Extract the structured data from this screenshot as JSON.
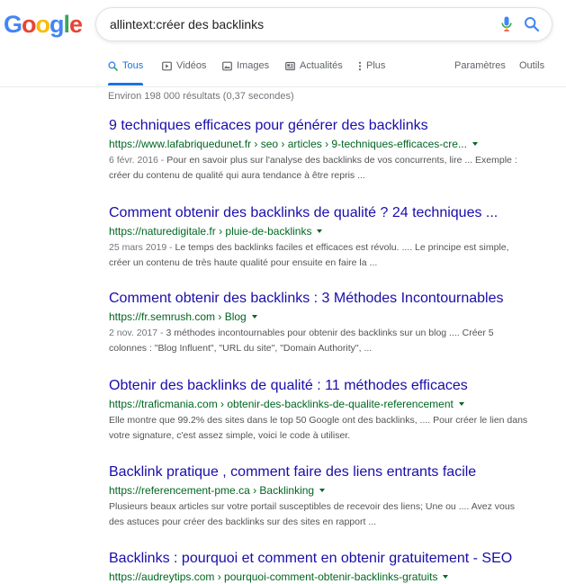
{
  "logo": {
    "l1": "G",
    "l2": "o",
    "l3": "o",
    "l4": "g",
    "l5": "l",
    "l6": "e"
  },
  "search": {
    "query": "allintext:créer des backlinks"
  },
  "icons": {
    "mic": "microphone-icon",
    "search": "search-icon"
  },
  "tabs": {
    "all": "Tous",
    "videos": "Vidéos",
    "images": "Images",
    "news": "Actualités",
    "more": "Plus",
    "settings": "Paramètres",
    "tools": "Outils"
  },
  "stats": "Environ 198 000 résultats (0,37 secondes)",
  "results": [
    {
      "title": "9 techniques efficaces pour générer des backlinks",
      "url": "https://www.lafabriquedunet.fr › seo › articles › 9-techniques-efficaces-cre...",
      "date": "6 févr. 2016 - ",
      "snippet": "Pour en savoir plus sur l'analyse des backlinks de vos concurrents, lire ... Exemple : créer du contenu de qualité qui aura tendance à être repris ..."
    },
    {
      "title": "Comment obtenir des backlinks de qualité ? 24 techniques ...",
      "url": "https://naturedigitale.fr › pluie-de-backlinks",
      "date": "25 mars 2019 - ",
      "snippet": "Le temps des backlinks faciles et efficaces est révolu. .... Le principe est simple, créer un contenu de très haute qualité pour ensuite en faire la ..."
    },
    {
      "title": "Comment obtenir des backlinks : 3 Méthodes Incontournables",
      "url": "https://fr.semrush.com › Blog",
      "date": "2 nov. 2017 - ",
      "snippet": "3 méthodes incontournables pour obtenir des backlinks sur un blog .... Créer 5 colonnes : \"Blog Influent\", \"URL du site\", \"Domain Authority\", ..."
    },
    {
      "title": "Obtenir des backlinks de qualité : 11 méthodes efficaces",
      "url": "https://traficmania.com › obtenir-des-backlinks-de-qualite-referencement",
      "date": "",
      "snippet": "Elle montre que 99.2% des sites dans le top 50 Google ont des backlinks, .... Pour créer le lien dans votre signature, c'est assez simple, voici le code à utiliser."
    },
    {
      "title": "Backlink pratique , comment faire des liens entrants facile",
      "url": "https://referencement-pme.ca › Backlinking",
      "date": "",
      "snippet": "Plusieurs beaux articles sur votre portail susceptibles de recevoir des liens; Une ou .... Avez vous des astuces pour créer des backlinks sur des sites en rapport ..."
    },
    {
      "title": "Backlinks : pourquoi et comment en obtenir gratuitement - SEO",
      "url": "https://audreytips.com › pourquoi-comment-obtenir-backlinks-gratuits"
    }
  ],
  "colors": {
    "title": "#1a0dab",
    "url": "#006621",
    "snippet": "#545454",
    "accent": "#1a73e8"
  }
}
